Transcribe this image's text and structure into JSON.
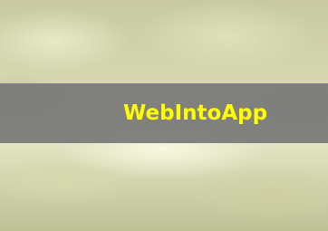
{
  "banner": {
    "title": "WebIntoApp"
  },
  "colors": {
    "title_color": "#ffff00",
    "band_color": "#787878",
    "background_tone": "#c6c79d"
  }
}
